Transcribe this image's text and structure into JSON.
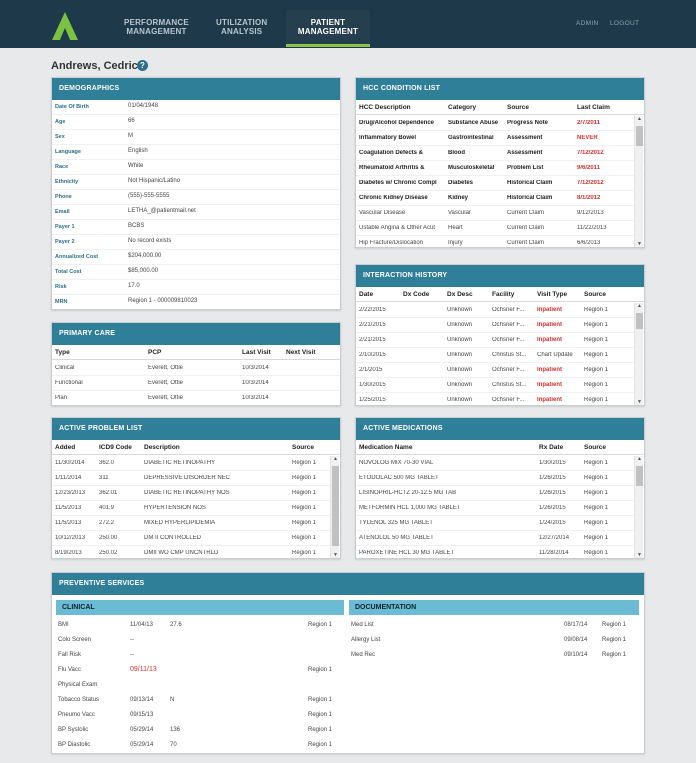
{
  "nav": {
    "items": [
      {
        "line1": "PERFORMANCE",
        "line2": "MANAGEMENT"
      },
      {
        "line1": "UTILIZATION",
        "line2": "ANALYSIS"
      },
      {
        "line1": "PATIENT",
        "line2": "MANAGEMENT"
      }
    ],
    "admin": "ADMIN",
    "logout": "LOGOUT"
  },
  "patient": {
    "name": "Andrews, Cedric t",
    "help": "?"
  },
  "demographics": {
    "title": "DEMOGRAPHICS",
    "rows": [
      {
        "k": "Date Of Birth",
        "v": "01/04/1948"
      },
      {
        "k": "Age",
        "v": "66"
      },
      {
        "k": "Sex",
        "v": "M"
      },
      {
        "k": "Language",
        "v": "English"
      },
      {
        "k": "Race",
        "v": "White"
      },
      {
        "k": "Ethnicity",
        "v": "Not Hispanic/Latino"
      },
      {
        "k": "Phone",
        "v": "(555)-555-5555"
      },
      {
        "k": "Email",
        "v": "LETHA_@patientmail.net"
      },
      {
        "k": "Payer 1",
        "v": "BCBS"
      },
      {
        "k": "Payer 2",
        "v": "No record exists"
      },
      {
        "k": "Annualized Cost",
        "v": "$204,000.00"
      },
      {
        "k": "Total Cost",
        "v": "$85,000.00"
      },
      {
        "k": "Risk",
        "v": "17.0"
      },
      {
        "k": "MRN",
        "v": "Region 1 - 000009810023"
      }
    ]
  },
  "primary_care": {
    "title": "PRIMARY CARE",
    "headers": [
      "Type",
      "PCP",
      "Last Visit",
      "Next Visit"
    ],
    "rows": [
      [
        "Clinical",
        "Everett, Ottie",
        "10/3/2014",
        ""
      ],
      [
        "Functional",
        "Everett, Ottie",
        "10/3/2014",
        ""
      ],
      [
        "Plan",
        "Everett, Ottie",
        "10/3/2014",
        ""
      ]
    ]
  },
  "problems": {
    "title": "ACTIVE PROBLEM LIST",
    "headers": [
      "Added",
      "ICD9 Code",
      "Description",
      "Source"
    ],
    "rows": [
      [
        "11/30/2014",
        "362.0",
        "DIABETIC RETINOPATHY",
        "Region 1"
      ],
      [
        "1/11/2014",
        "311",
        "DEPRESSIVE DISORDER NEC",
        "Region 1"
      ],
      [
        "12/23/2013",
        "362.01",
        "DIABETIC RETINOPATHY NOS",
        "Region 1"
      ],
      [
        "11/5/2013",
        "401.9",
        "HYPERTENSION NOS",
        "Region 1"
      ],
      [
        "11/5/2013",
        "272.2",
        "MIXED HYPERLIPIDEMIA",
        "Region 1"
      ],
      [
        "10/12/2013",
        "250.00",
        "DM II CONTROLLED",
        "Region 1"
      ],
      [
        "8/19/2013",
        "250.02",
        "DMII WO CMP UNCNTRLD",
        "Region 1"
      ]
    ]
  },
  "hcc": {
    "title": "HCC CONDITION LIST",
    "headers": [
      "HCC Description",
      "Category",
      "Source",
      "Last Claim"
    ],
    "rows": [
      [
        "Drug/Alcohol Dependence",
        "Substance Abuse",
        "Progress Note",
        "2/7/2011"
      ],
      [
        "Inflammatory Bowel",
        "Gastrointestinal",
        "Assessment",
        "NEVER"
      ],
      [
        "Coagulation Defects &",
        "Blood",
        "Assessment",
        "7/12/2012"
      ],
      [
        "Rheumatoid Arthritis &",
        "Musculoskeletal",
        "Problem List",
        "9/6/2011"
      ],
      [
        "Diabetes w/ Chronic Compl",
        "Diabetes",
        "Historical Claim",
        "7/12/2012"
      ],
      [
        "Chronic Kidney Disease",
        "Kidney",
        "Historical Claim",
        "8/1/2012"
      ],
      [
        "Vascular Disease",
        "Vascular",
        "Current Claim",
        "9/12/2013"
      ],
      [
        "Ustable Angina & Other Acut",
        "Heart",
        "Current Claim",
        "11/22/2013"
      ],
      [
        "Hip Fracture/Dislocation",
        "Injury",
        "Current Claim",
        "6/6/2013"
      ]
    ]
  },
  "interactions": {
    "title": "INTERACTION HISTORY",
    "headers": [
      "Date",
      "Dx Code",
      "Dx Desc",
      "Facility",
      "Visit Type",
      "Source"
    ],
    "rows": [
      [
        "2/22/2015",
        "",
        "Unknown",
        "Ochsner F...",
        "Inpatient",
        "Region 1"
      ],
      [
        "2/21/2015",
        "",
        "Unknown",
        "Ochsner F...",
        "Inpatient",
        "Region 1"
      ],
      [
        "2/21/2015",
        "",
        "Unknown",
        "Ochsner F...",
        "Inpatient",
        "Region 1"
      ],
      [
        "2/10/2015",
        "",
        "Unknown",
        "Christus St...",
        "Chart Update",
        "Region 1"
      ],
      [
        "2/1/2015",
        "",
        "Unknown",
        "Ochsner F...",
        "Inpatient",
        "Region 1"
      ],
      [
        "1/30/2015",
        "",
        "Unknown",
        "Christus St...",
        "Inpatient",
        "Region 1"
      ],
      [
        "1/25/2015",
        "",
        "Unknown",
        "Ochsner F...",
        "Inpatient",
        "Region 1"
      ]
    ]
  },
  "medications": {
    "title": "ACTIVE MEDICATIONS",
    "headers": [
      "Medication Name",
      "Rx Date",
      "Source"
    ],
    "rows": [
      [
        "NOVOLOG MIX 70-30 VIAL",
        "1/30/2015",
        "Region 1"
      ],
      [
        "ETODOLAC 500 MG TABLET",
        "1/26/2015",
        "Region 1"
      ],
      [
        "LISINOPRIL-HCTZ 20-12.5 MG TAB",
        "1/26/2015",
        "Region 1"
      ],
      [
        "METFORMIN HCL 1,000 MG TABLET",
        "1/26/2015",
        "Region 1"
      ],
      [
        "TYLENOL 325 MG TABLET",
        "1/24/2015",
        "Region 1"
      ],
      [
        "ATENOLOL 50 MG TABLET",
        "12/27/2014",
        "Region 1"
      ],
      [
        "PAROXETINE HCL 30 MG TABLET",
        "11/28/2014",
        "Region 1"
      ]
    ]
  },
  "preventive": {
    "title": "PREVENTIVE SERVICES",
    "clinical_title": "CLINICAL",
    "documentation_title": "DOCUMENTATION",
    "clinical": [
      [
        "BMI",
        "11/04/13",
        "27.6",
        "Region 1"
      ],
      [
        "Colo Screen",
        "--",
        "",
        ""
      ],
      [
        "Fall Risk",
        "--",
        "",
        ""
      ],
      [
        "Flu Vacc",
        "09/11/13",
        "",
        "Region 1"
      ],
      [
        "Physical Exam",
        "",
        "",
        ""
      ],
      [
        "Tobacco Status",
        "09/13/14",
        "N",
        "Region 1"
      ],
      [
        "Pneumo Vacc",
        "09/15/13",
        "",
        "Region 1"
      ],
      [
        "BP Systolic",
        "05/29/14",
        "136",
        "Region 1"
      ],
      [
        "BP Diastolic",
        "05/29/14",
        "70",
        "Region 1"
      ]
    ],
    "documentation": [
      [
        "Med List",
        "08/17/14",
        "Region 1"
      ],
      [
        "Allergy List",
        "09/08/14",
        "Region 1"
      ],
      [
        "Med Rec",
        "09/10/14",
        "Region 1"
      ]
    ]
  },
  "colors": {
    "header_bg": "#1e3a4a",
    "panel_head": "#2f7f98",
    "sub_head": "#6bbcd3",
    "accent": "#8bc34a",
    "alert": "#d32f2f"
  }
}
